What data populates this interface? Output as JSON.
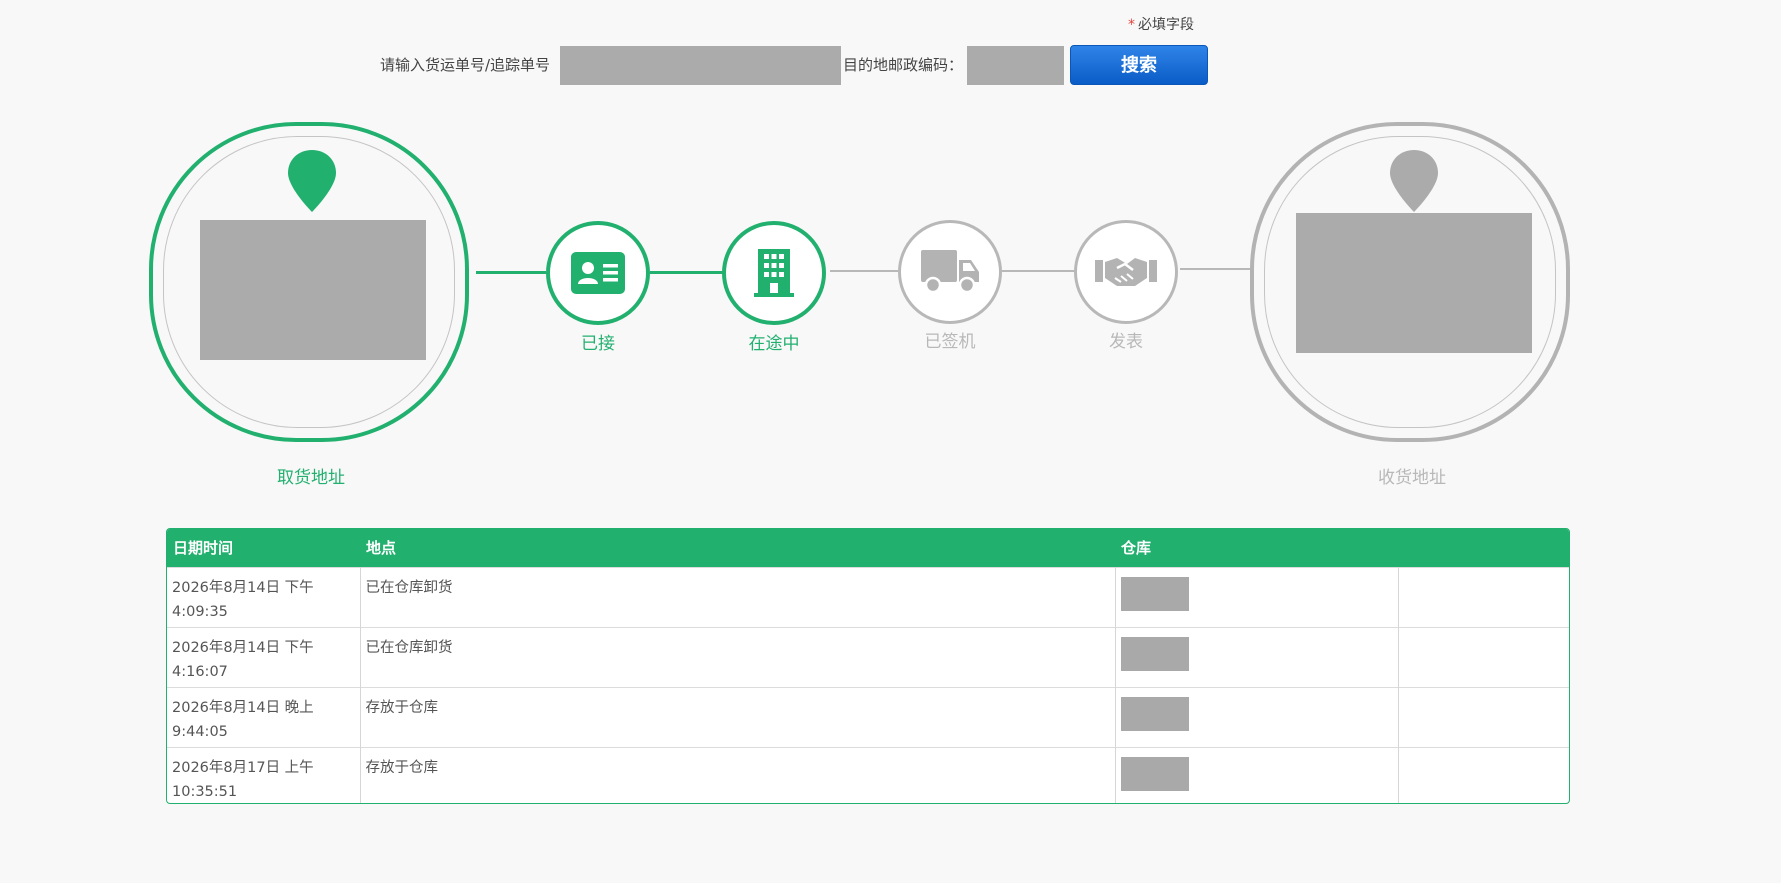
{
  "search": {
    "required_star": "*",
    "required_note": "必填字段",
    "tracking_label": "请输入货运单号/追踪单号",
    "tracking_value": "",
    "postal_label": "目的地邮政编码：",
    "postal_value": "",
    "search_button": "搜索"
  },
  "progress": {
    "pickup_label": "取货地址",
    "delivery_label": "收货地址",
    "steps": [
      {
        "label": "已接",
        "icon": "id-card-icon",
        "status": "done"
      },
      {
        "label": "在途中",
        "icon": "building-icon",
        "status": "done"
      },
      {
        "label": "已签机",
        "icon": "truck-icon",
        "status": "pending"
      },
      {
        "label": "发表",
        "icon": "handshake-icon",
        "status": "pending"
      }
    ]
  },
  "table": {
    "headers": [
      "日期时间",
      "地点",
      "仓库",
      ""
    ],
    "rows": [
      {
        "datetime_line1": "2026年8月14日 下午",
        "datetime_line2": "4:09:35",
        "location": "已在仓库卸货"
      },
      {
        "datetime_line1": "2026年8月14日 下午",
        "datetime_line2": "4:16:07",
        "location": "已在仓库卸货"
      },
      {
        "datetime_line1": "2026年8月14日 晚上",
        "datetime_line2": "9:44:05",
        "location": "存放于仓库"
      },
      {
        "datetime_line1": "2026年8月17日 上午",
        "datetime_line2": "10:35:51",
        "location": "存放于仓库"
      }
    ]
  },
  "colors": {
    "accent_green": "#22b06f",
    "button_blue": "#0a5cc6",
    "inactive_gray": "#b8b8b8",
    "redacted_gray": "#ababab"
  }
}
